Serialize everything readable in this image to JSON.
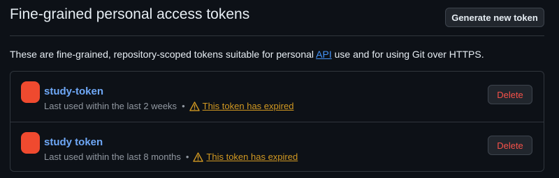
{
  "header": {
    "title": "Fine-grained personal access tokens",
    "generate_button_label": "Generate new token"
  },
  "description": {
    "text_before": "These are fine-grained, repository-scoped tokens suitable for personal ",
    "api_link": "API",
    "text_after": " use and for using Git over HTTPS."
  },
  "colors": {
    "background": "#0d1117",
    "link": "#4493f8",
    "warning": "#d29922",
    "danger": "#f85149",
    "avatar": "#ef4a2f"
  },
  "tokens": [
    {
      "name": "study-token",
      "last_used": "Last used within the last 2 weeks",
      "separator": "•",
      "status_icon": "alert-triangle-icon",
      "status": "This token has expired",
      "delete_label": "Delete"
    },
    {
      "name": "study token",
      "last_used": "Last used within the last 8 months",
      "separator": "•",
      "status_icon": "alert-triangle-icon",
      "status": "This token has expired",
      "delete_label": "Delete"
    }
  ]
}
